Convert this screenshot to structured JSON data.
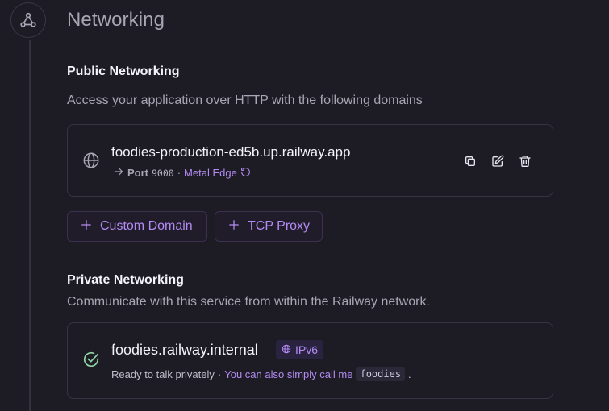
{
  "section": {
    "title": "Networking",
    "icon": "network-nodes-icon"
  },
  "public": {
    "heading": "Public Networking",
    "description": "Access your application over HTTP with the following domains",
    "domain": {
      "url": "foodies-production-ed5b.up.railway.app",
      "port_label": "Port",
      "port_value": "9000",
      "separator": "·",
      "edge_label": "Metal Edge",
      "icons": [
        "globe-icon",
        "arrow-right-icon",
        "refresh-icon",
        "copy-icon",
        "edit-icon",
        "trash-icon"
      ]
    },
    "buttons": {
      "custom_domain": "Custom Domain",
      "tcp_proxy": "TCP Proxy"
    }
  },
  "private": {
    "heading": "Private Networking",
    "description": "Communicate with this service from within the Railway network.",
    "host": "foodies.railway.internal",
    "badge": "IPv6",
    "status_text": "Ready to talk privately",
    "separator": "·",
    "call_text": "You can also simply call me",
    "alias": "foodies",
    "period": "."
  },
  "colors": {
    "background": "#1d1c24",
    "accent": "#b38bf2",
    "border": "#363443",
    "muted_text": "#a8a6b4",
    "success": "#8fd3a6"
  }
}
